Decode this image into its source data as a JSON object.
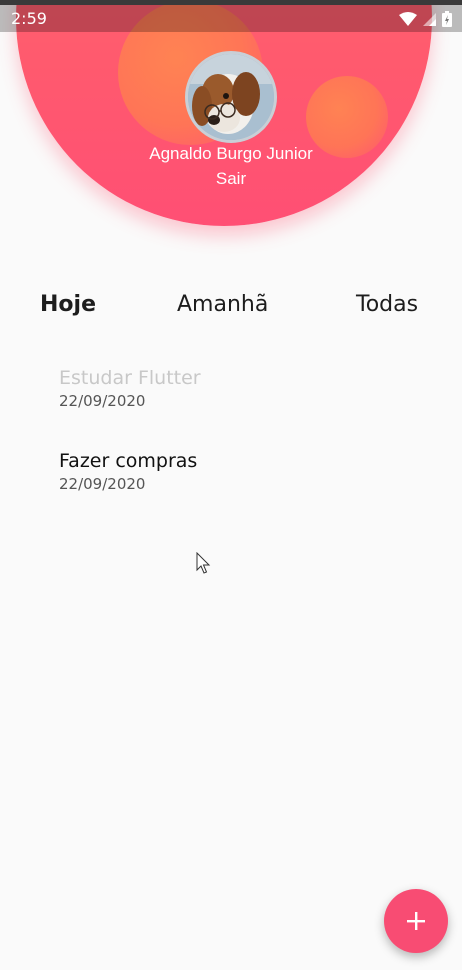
{
  "status_bar": {
    "time": "2:59",
    "icons": [
      "wifi-icon",
      "signal-icon",
      "battery-icon"
    ]
  },
  "header": {
    "user_name": "Agnaldo Burgo Junior",
    "logout_label": "Sair",
    "avatar": "dog-photo-avatar",
    "colors": {
      "gradient_start": "#ff6e6e",
      "gradient_end": "#ff4f74",
      "bubble": "#ff8a4e"
    }
  },
  "tabs": [
    {
      "label": "Hoje",
      "selected": true
    },
    {
      "label": "Amanhã",
      "selected": false
    },
    {
      "label": "Todas",
      "selected": false
    }
  ],
  "tasks": [
    {
      "title": "Estudar Flutter",
      "date": "22/09/2020",
      "done": true
    },
    {
      "title": "Fazer compras",
      "date": "22/09/2020",
      "done": false
    }
  ],
  "fab": {
    "icon": "plus-icon",
    "color": "#f84c73"
  },
  "theme": {
    "accent": "#f84c73",
    "background": "#fafafa"
  }
}
